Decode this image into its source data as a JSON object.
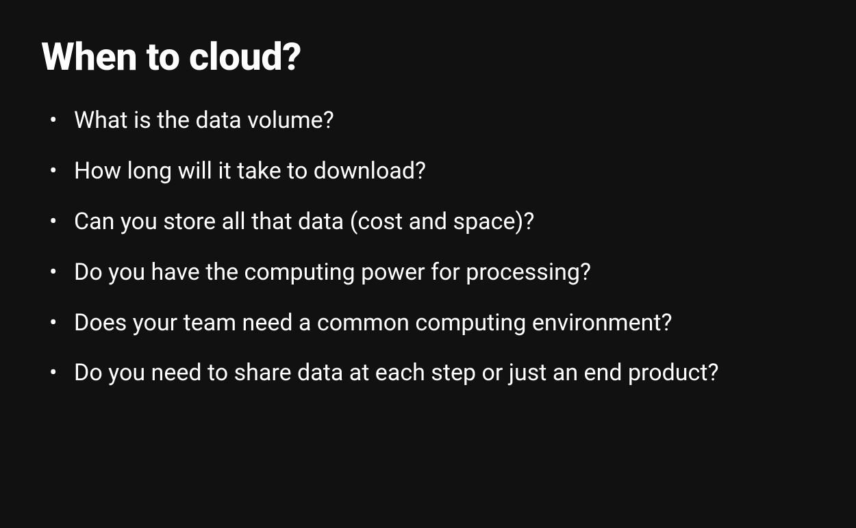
{
  "slide": {
    "title": "When to cloud?",
    "bullets": [
      "What is the data volume?",
      "How long will it take to download?",
      "Can you store all that data (cost and space)?",
      "Do you have the computing power for processing?",
      "Does your team need a common computing environment?",
      "Do you need to share data at each step or just an end product?"
    ]
  }
}
